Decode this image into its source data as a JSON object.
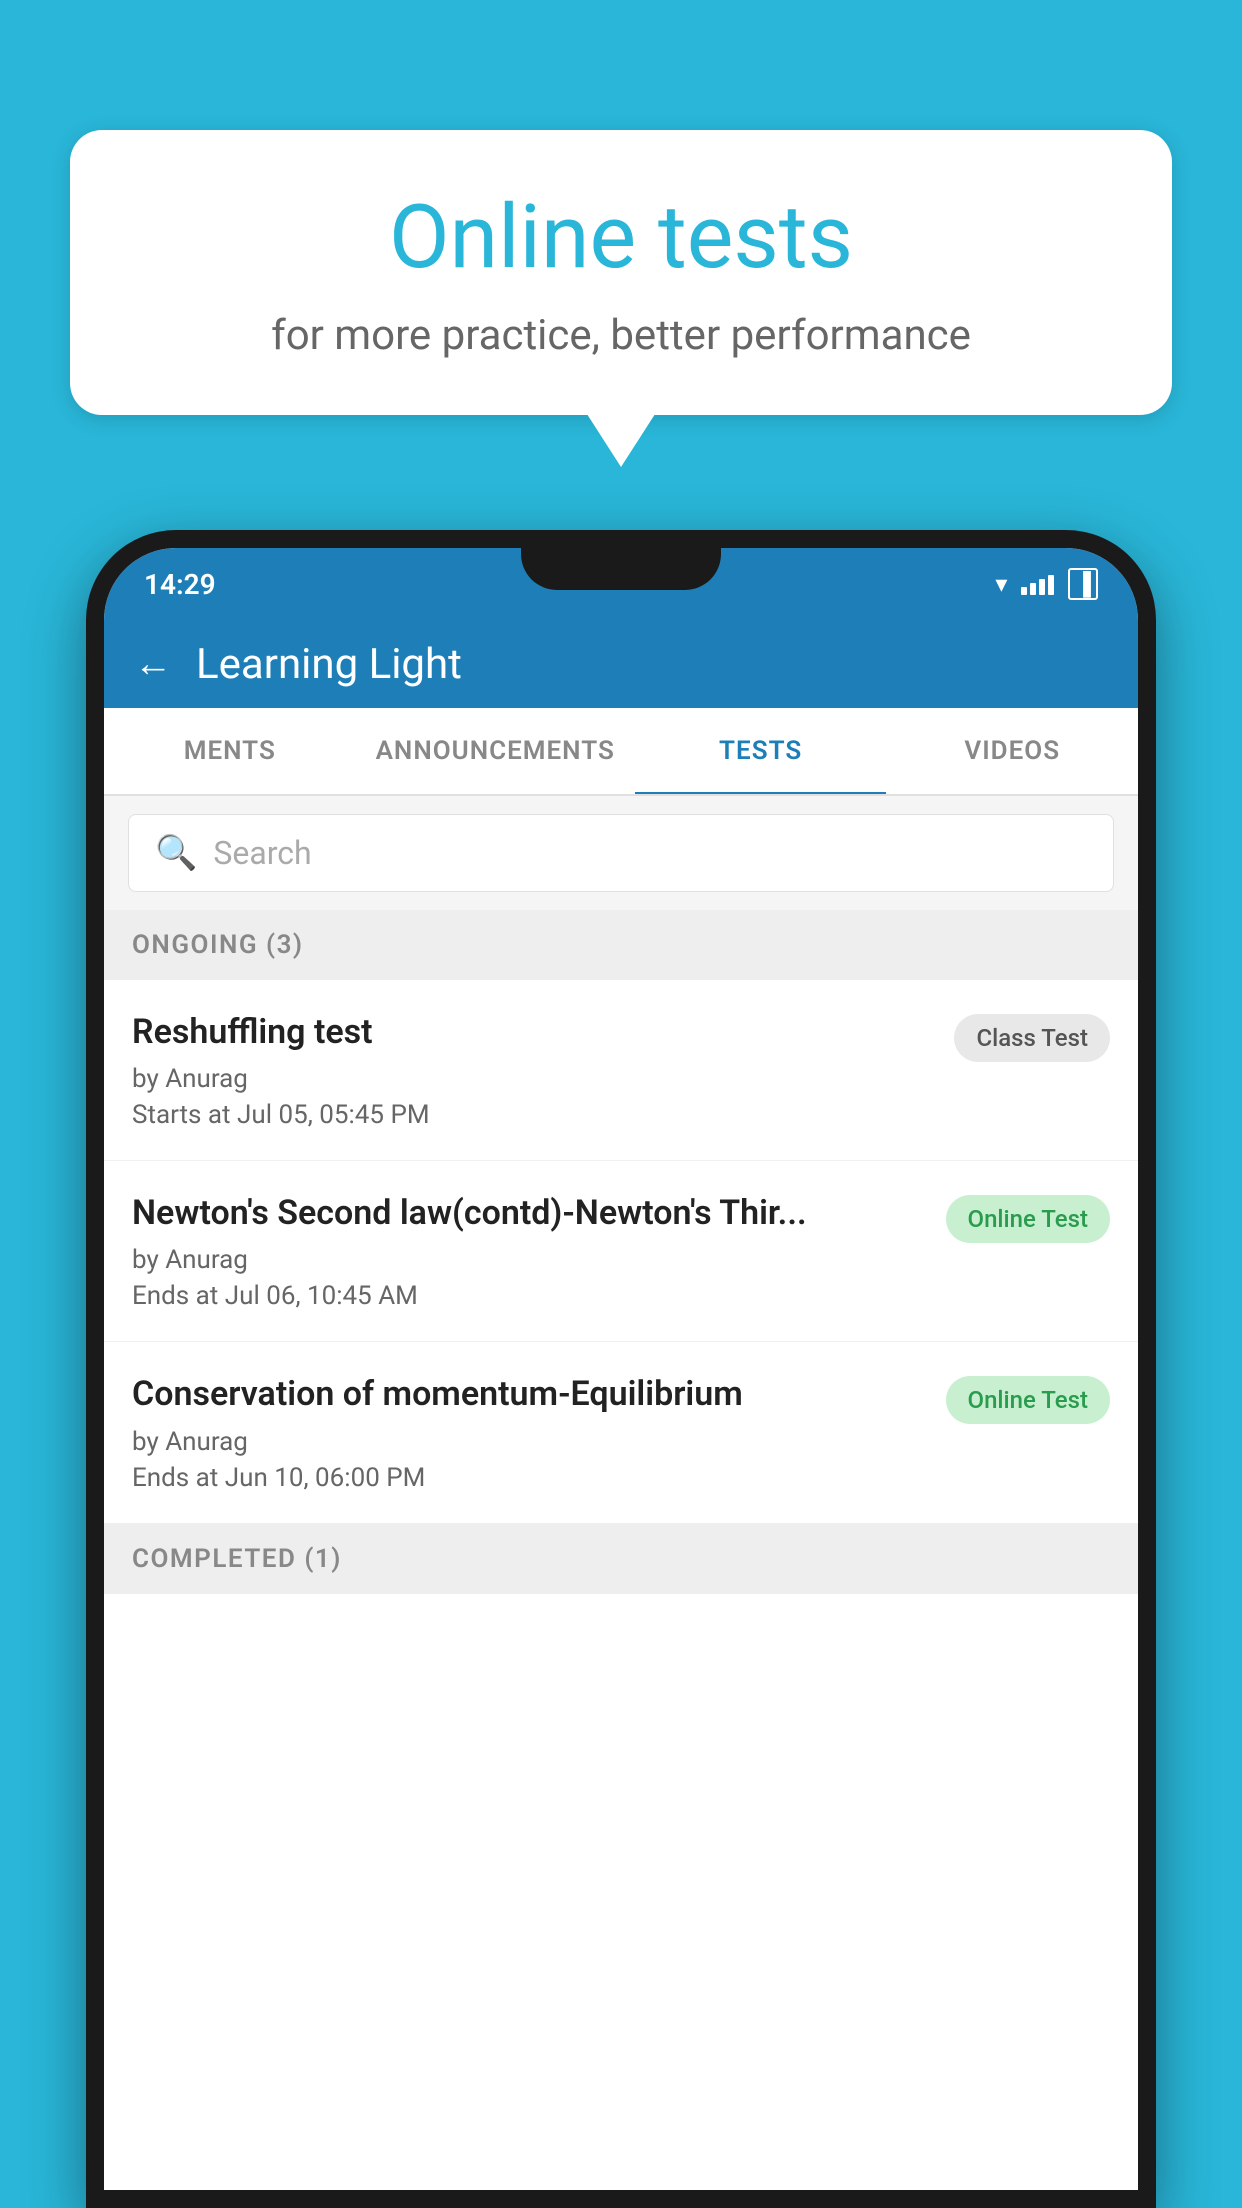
{
  "background_color": "#29b6d8",
  "bubble": {
    "title": "Online tests",
    "subtitle": "for more practice, better performance"
  },
  "status_bar": {
    "time": "14:29",
    "wifi": "▼",
    "battery": "▐"
  },
  "app_header": {
    "title": "Learning Light",
    "back_label": "←"
  },
  "tabs": [
    {
      "label": "MENTS",
      "active": false
    },
    {
      "label": "ANNOUNCEMENTS",
      "active": false
    },
    {
      "label": "TESTS",
      "active": true
    },
    {
      "label": "VIDEOS",
      "active": false
    }
  ],
  "search": {
    "placeholder": "Search"
  },
  "ongoing_section": {
    "label": "ONGOING (3)"
  },
  "tests": [
    {
      "name": "Reshuffling test",
      "by": "by Anurag",
      "time_label": "Starts at",
      "time": "Jul 05, 05:45 PM",
      "badge": "Class Test",
      "badge_type": "class"
    },
    {
      "name": "Newton's Second law(contd)-Newton's Thir...",
      "by": "by Anurag",
      "time_label": "Ends at",
      "time": "Jul 06, 10:45 AM",
      "badge": "Online Test",
      "badge_type": "online"
    },
    {
      "name": "Conservation of momentum-Equilibrium",
      "by": "by Anurag",
      "time_label": "Ends at",
      "time": "Jun 10, 06:00 PM",
      "badge": "Online Test",
      "badge_type": "online"
    }
  ],
  "completed_section": {
    "label": "COMPLETED (1)"
  }
}
